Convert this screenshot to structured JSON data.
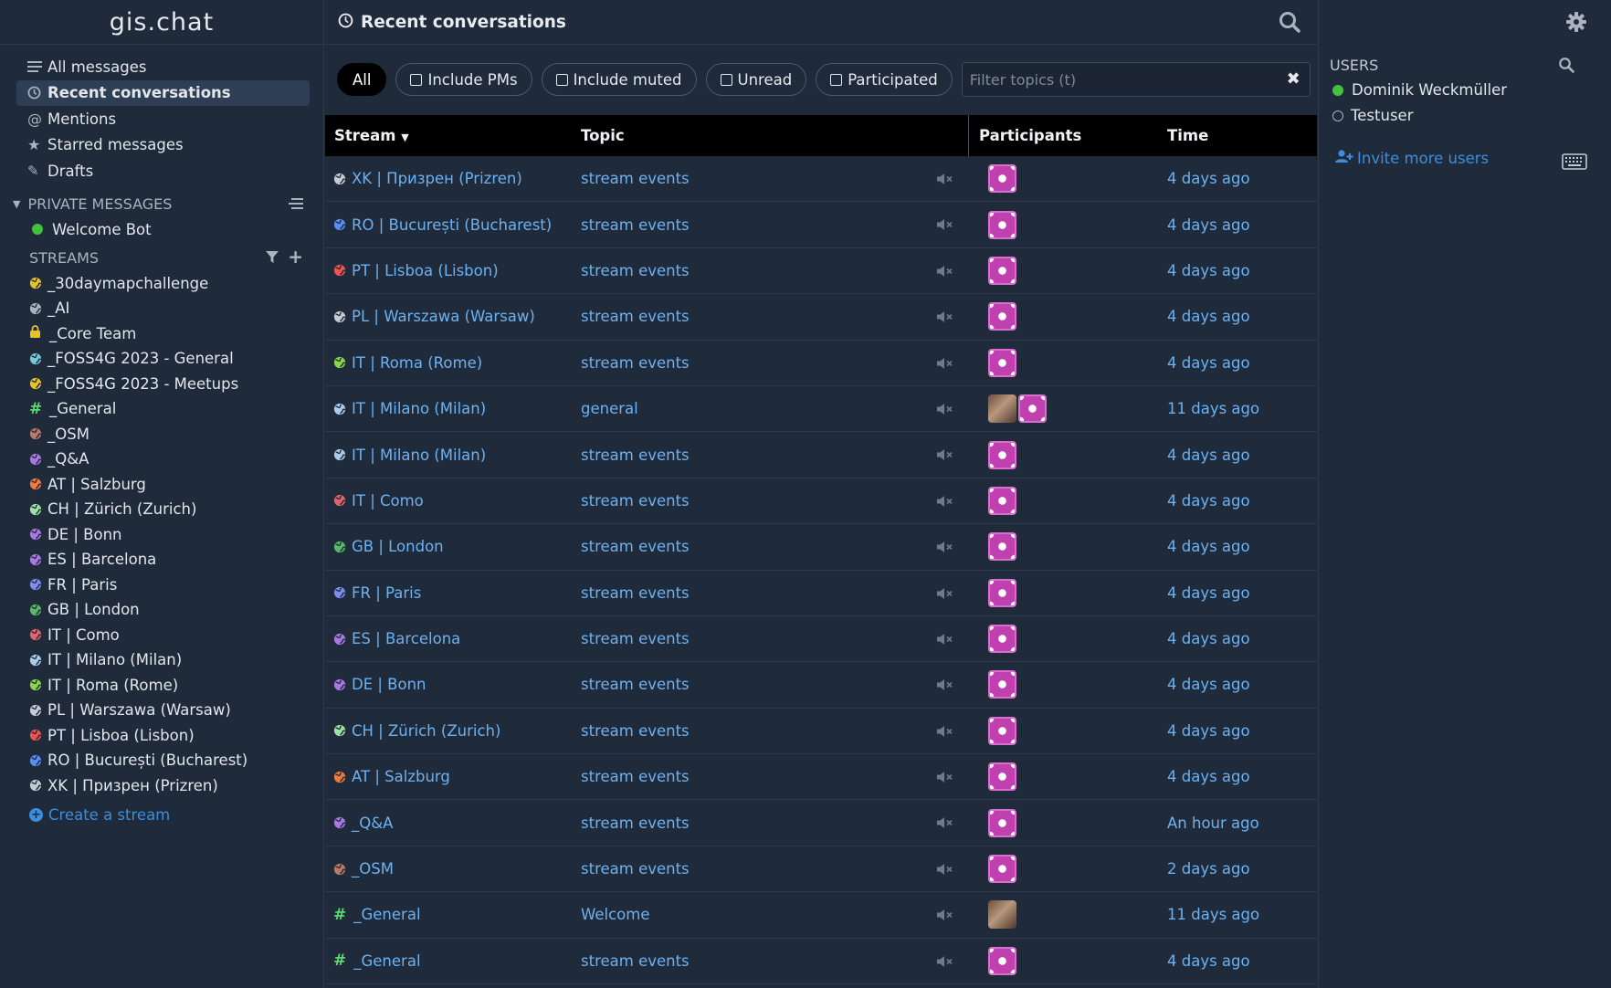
{
  "brand": "gis.chat",
  "nav": [
    {
      "label": "All messages",
      "icon": "list-icon"
    },
    {
      "label": "Recent conversations",
      "icon": "clock-icon"
    },
    {
      "label": "Mentions",
      "icon": "at-icon"
    },
    {
      "label": "Starred messages",
      "icon": "star-icon"
    },
    {
      "label": "Drafts",
      "icon": "pencil-icon"
    }
  ],
  "private_messages": {
    "header": "PRIVATE MESSAGES",
    "items": [
      {
        "label": "Welcome Bot",
        "status_color": "#44c23b"
      }
    ]
  },
  "streams": {
    "header": "STREAMS",
    "items": [
      {
        "label": "_30daymapchallenge",
        "color": "#e6c229",
        "icon": "globe"
      },
      {
        "label": "_AI",
        "color": "#aab3be",
        "icon": "globe"
      },
      {
        "label": "_Core Team",
        "color": "#e6c229",
        "icon": "lock"
      },
      {
        "label": "_FOSS4G 2023 - General",
        "color": "#76c7d8",
        "icon": "globe"
      },
      {
        "label": "_FOSS4G 2023 - Meetups",
        "color": "#e6c229",
        "icon": "globe"
      },
      {
        "label": "_General",
        "color": "#5bd86e",
        "icon": "hash"
      },
      {
        "label": "_OSM",
        "color": "#b97a65",
        "icon": "globe"
      },
      {
        "label": "_Q&A",
        "color": "#a978e0",
        "icon": "globe"
      },
      {
        "label": "AT | Salzburg",
        "color": "#ef7a3c",
        "icon": "globe"
      },
      {
        "label": "CH | Zürich (Zurich)",
        "color": "#9fe0a3",
        "icon": "globe"
      },
      {
        "label": "DE | Bonn",
        "color": "#a978e0",
        "icon": "globe"
      },
      {
        "label": "ES | Barcelona",
        "color": "#a978e0",
        "icon": "globe"
      },
      {
        "label": "FR | Paris",
        "color": "#7c8ef0",
        "icon": "globe"
      },
      {
        "label": "GB | London",
        "color": "#58b968",
        "icon": "globe"
      },
      {
        "label": "IT | Como",
        "color": "#e0636e",
        "icon": "globe"
      },
      {
        "label": "IT | Milano (Milan)",
        "color": "#aacbea",
        "icon": "globe"
      },
      {
        "label": "IT | Roma (Rome)",
        "color": "#8bd642",
        "icon": "globe"
      },
      {
        "label": "PL | Warszawa (Warsaw)",
        "color": "#c4cbd4",
        "icon": "globe"
      },
      {
        "label": "PT | Lisboa (Lisbon)",
        "color": "#ef5350",
        "icon": "globe"
      },
      {
        "label": "RO | București (Bucharest)",
        "color": "#5b8ef5",
        "icon": "globe"
      },
      {
        "label": "XK | Призрен (Prizren)",
        "color": "#c4cbd4",
        "icon": "globe"
      }
    ],
    "create_label": "Create a stream"
  },
  "header": {
    "title": "Recent conversations"
  },
  "filters": {
    "all": "All",
    "include_pms": "Include PMs",
    "include_muted": "Include muted",
    "unread": "Unread",
    "participated": "Participated",
    "search_placeholder": "Filter topics (t)"
  },
  "table": {
    "columns": {
      "stream": "Stream",
      "topic": "Topic",
      "participants": "Participants",
      "time": "Time"
    },
    "rows": [
      {
        "stream": "XK | Призрен (Prizren)",
        "color": "#c4cbd4",
        "icon": "globe",
        "topic": "stream events",
        "participants": [
          "pattern"
        ],
        "time": "4 days ago"
      },
      {
        "stream": "RO | București (Bucharest)",
        "color": "#5b8ef5",
        "icon": "globe",
        "topic": "stream events",
        "participants": [
          "pattern"
        ],
        "time": "4 days ago"
      },
      {
        "stream": "PT | Lisboa (Lisbon)",
        "color": "#ef5350",
        "icon": "globe",
        "topic": "stream events",
        "participants": [
          "pattern"
        ],
        "time": "4 days ago"
      },
      {
        "stream": "PL | Warszawa (Warsaw)",
        "color": "#c4cbd4",
        "icon": "globe",
        "topic": "stream events",
        "participants": [
          "pattern"
        ],
        "time": "4 days ago"
      },
      {
        "stream": "IT | Roma (Rome)",
        "color": "#8bd642",
        "icon": "globe",
        "topic": "stream events",
        "participants": [
          "pattern"
        ],
        "time": "4 days ago"
      },
      {
        "stream": "IT | Milano (Milan)",
        "color": "#aacbea",
        "icon": "globe",
        "topic": "general",
        "participants": [
          "photo",
          "pattern"
        ],
        "time": "11 days ago"
      },
      {
        "stream": "IT | Milano (Milan)",
        "color": "#aacbea",
        "icon": "globe",
        "topic": "stream events",
        "participants": [
          "pattern"
        ],
        "time": "4 days ago"
      },
      {
        "stream": "IT | Como",
        "color": "#e0636e",
        "icon": "globe",
        "topic": "stream events",
        "participants": [
          "pattern"
        ],
        "time": "4 days ago"
      },
      {
        "stream": "GB | London",
        "color": "#58b968",
        "icon": "globe",
        "topic": "stream events",
        "participants": [
          "pattern"
        ],
        "time": "4 days ago"
      },
      {
        "stream": "FR | Paris",
        "color": "#7c8ef0",
        "icon": "globe",
        "topic": "stream events",
        "participants": [
          "pattern"
        ],
        "time": "4 days ago"
      },
      {
        "stream": "ES | Barcelona",
        "color": "#a978e0",
        "icon": "globe",
        "topic": "stream events",
        "participants": [
          "pattern"
        ],
        "time": "4 days ago"
      },
      {
        "stream": "DE | Bonn",
        "color": "#a978e0",
        "icon": "globe",
        "topic": "stream events",
        "participants": [
          "pattern"
        ],
        "time": "4 days ago"
      },
      {
        "stream": "CH | Zürich (Zurich)",
        "color": "#9fe0a3",
        "icon": "globe",
        "topic": "stream events",
        "participants": [
          "pattern"
        ],
        "time": "4 days ago"
      },
      {
        "stream": "AT | Salzburg",
        "color": "#ef7a3c",
        "icon": "globe",
        "topic": "stream events",
        "participants": [
          "pattern"
        ],
        "time": "4 days ago"
      },
      {
        "stream": "_Q&A",
        "color": "#a978e0",
        "icon": "globe",
        "topic": "stream events",
        "participants": [
          "pattern"
        ],
        "time": "An hour ago"
      },
      {
        "stream": "_OSM",
        "color": "#b97a65",
        "icon": "globe",
        "topic": "stream events",
        "participants": [
          "pattern"
        ],
        "time": "2 days ago"
      },
      {
        "stream": "_General",
        "color": "#5bd86e",
        "icon": "hash",
        "topic": "Welcome",
        "participants": [
          "photo"
        ],
        "time": "11 days ago"
      },
      {
        "stream": "_General",
        "color": "#5bd86e",
        "icon": "hash",
        "topic": "stream events",
        "participants": [
          "pattern"
        ],
        "time": "4 days ago"
      }
    ]
  },
  "users_panel": {
    "header": "USERS",
    "users": [
      {
        "name": "Dominik Weckmüller",
        "status": "active"
      },
      {
        "name": "Testuser",
        "status": "offline"
      }
    ],
    "invite_label": "Invite more users"
  }
}
